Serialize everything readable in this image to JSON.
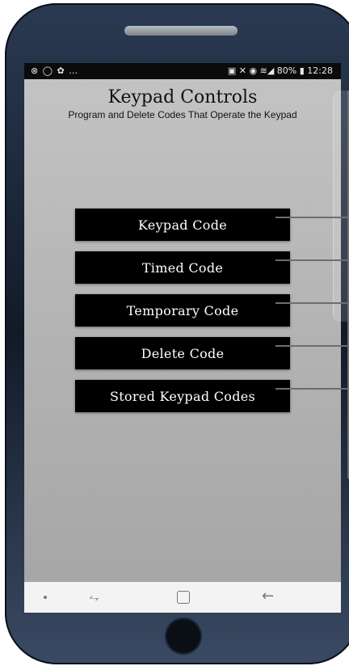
{
  "status_bar": {
    "left_icons": "⊗ ◯ ✿ …",
    "right_icons": "▣ ✕ ◉ ≋◢",
    "battery": "80%",
    "time": "12:28"
  },
  "page": {
    "title": "Keypad Controls",
    "subtitle": "Program and Delete Codes That Operate the Keypad"
  },
  "buttons": [
    {
      "label": "Keypad Code"
    },
    {
      "label": "Timed Code"
    },
    {
      "label": "Temporary Code"
    },
    {
      "label": "Delete Code"
    },
    {
      "label": "Stored Keypad Codes"
    }
  ],
  "navbar": {
    "dot_icon": "dot-icon",
    "recents_icon": "recents-icon",
    "home_icon": "home-icon",
    "back_icon": "back-arrow-icon"
  },
  "colors": {
    "screen_bg_top": "#c4c4c4",
    "button_bg": "#000000",
    "button_text": "#ffffff",
    "phone_body": "#1b2636"
  }
}
